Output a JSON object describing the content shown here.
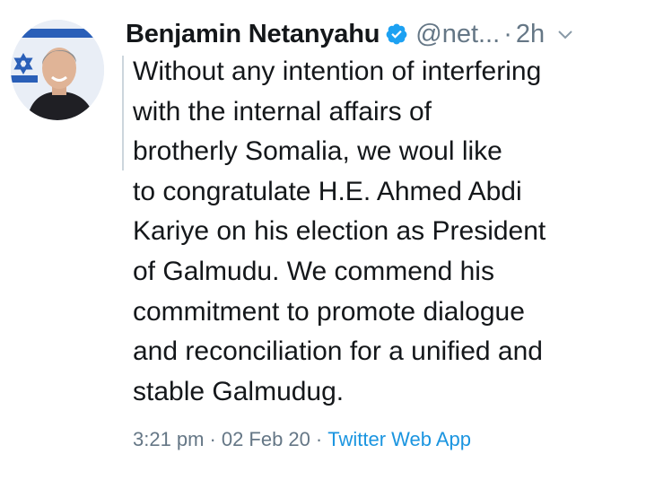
{
  "tweet": {
    "author_name": "Benjamin Netanyahu",
    "handle": "@net...",
    "separator": "·",
    "relative_time": "2h",
    "verified": true,
    "lines": [
      "Without any intention of interfering",
      "with the internal affairs of",
      "brotherly Somalia, we woul like",
      "to congratulate H.E. Ahmed Abdi",
      "Kariye on his election as President",
      "of Galmudu.  We commend his",
      "commitment to promote dialogue",
      "and reconciliation for a unified and",
      "stable Galmudug."
    ],
    "timestamp": "3:21 pm",
    "date": "02 Feb 20",
    "source": "Twitter Web App"
  },
  "icons": {
    "avatar": "profile-photo",
    "verified": "verified-badge-icon",
    "menu": "chevron-down-icon"
  },
  "colors": {
    "verified": "#1da1f2",
    "secondary_text": "#657786",
    "link": "#1b95e0",
    "primary_text": "#14171a"
  }
}
